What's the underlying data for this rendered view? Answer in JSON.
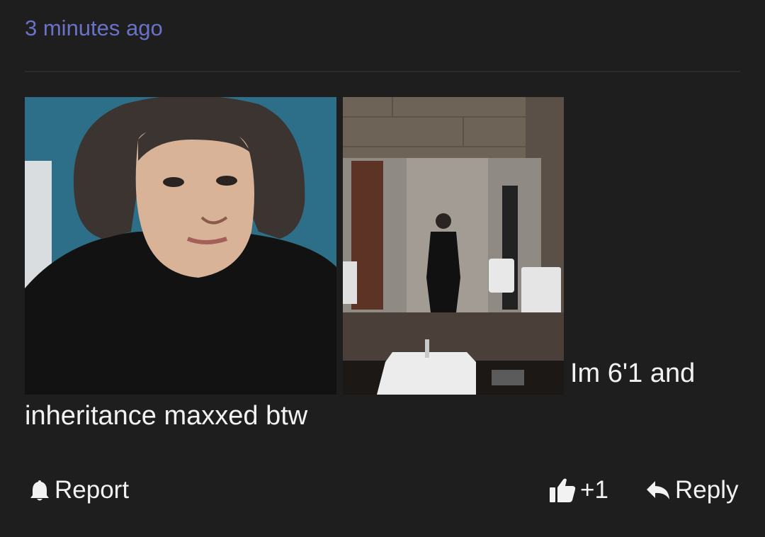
{
  "comment": {
    "timestamp": "3 minutes ago",
    "text_after_images": "Im 6'1 and inheritance maxxed btw",
    "images": [
      {
        "name": "selfie-photo"
      },
      {
        "name": "mirror-selfie-photo"
      }
    ]
  },
  "actions": {
    "report_label": "Report",
    "like_count": "+1",
    "reply_label": "Reply"
  },
  "colors": {
    "background": "#1e1e1e",
    "timestamp": "#6a72c8",
    "text": "#f2f2f2",
    "divider": "#2c2c2c"
  },
  "icons": {
    "report": "bell-icon",
    "like": "thumbs-up-icon",
    "reply": "reply-arrow-icon"
  }
}
